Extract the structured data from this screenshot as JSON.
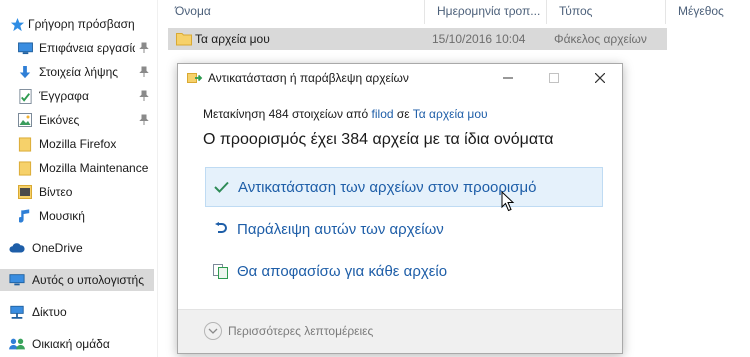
{
  "nav": {
    "quick_access": "Γρήγορη πρόσβαση",
    "items": [
      {
        "label": "Επιφάνεια εργασίας",
        "pinned": true,
        "icon": "desktop-icon"
      },
      {
        "label": "Στοιχεία λήψης",
        "pinned": true,
        "icon": "downloads-icon"
      },
      {
        "label": "Έγγραφα",
        "pinned": true,
        "icon": "documents-icon"
      },
      {
        "label": "Εικόνες",
        "pinned": true,
        "icon": "pictures-icon"
      },
      {
        "label": "Mozilla Firefox",
        "pinned": false,
        "icon": "folder-icon"
      },
      {
        "label": "Mozilla Maintenance",
        "pinned": false,
        "icon": "folder-icon"
      },
      {
        "label": "Βίντεο",
        "pinned": false,
        "icon": "videos-icon"
      },
      {
        "label": "Μουσική",
        "pinned": false,
        "icon": "music-icon"
      }
    ],
    "onedrive": "OneDrive",
    "this_pc": "Αυτός ο υπολογιστής",
    "network": "Δίκτυο",
    "homegroup": "Οικιακή ομάδα"
  },
  "columns": {
    "name": "Όνομα",
    "date": "Ημερομηνία τροπ...",
    "type": "Τύπος",
    "size": "Μέγεθος"
  },
  "row": {
    "name": "Τα αρχεία μου",
    "date": "15/10/2016 10:04",
    "type": "Φάκελος αρχείων"
  },
  "dialog": {
    "title": "Αντικατάσταση ή παράβλεψη αρχείων",
    "status_prefix": "Μετακίνηση 484 στοιχείων από ",
    "source": "filod",
    "status_middle": " σε ",
    "destination": "Τα αρχεία μου",
    "heading": "Ο προορισμός έχει 384 αρχεία με τα ίδια ονόματα",
    "option_replace": "Αντικατάσταση των αρχείων στον προορισμό",
    "option_skip": "Παράλειψη αυτών των αρχείων",
    "option_decide": "Θα αποφασίσω για κάθε αρχείο",
    "more_details": "Περισσότερες λεπτομέρειες"
  },
  "colors": {
    "link_blue": "#1e5ea8",
    "selection_gray": "#d9d9d9",
    "hover_blue": "#e5f1fb",
    "folder_yellow": "#f6d16a",
    "check_green": "#2e8b57"
  }
}
